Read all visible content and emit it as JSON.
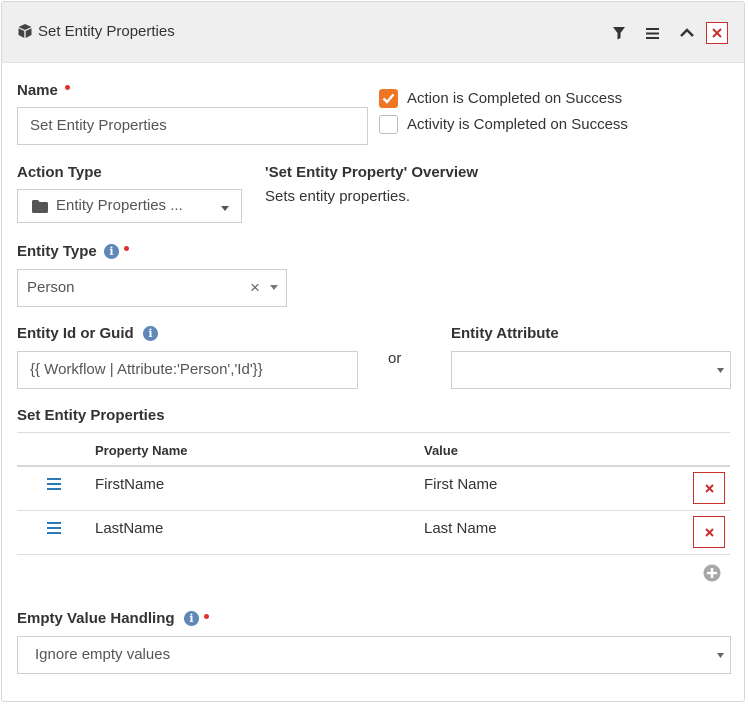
{
  "header": {
    "title": "Set Entity Properties",
    "icon": "cube-icon",
    "buttons": [
      "filter-icon",
      "menu-icon",
      "chevron-up-icon",
      "close-icon"
    ]
  },
  "form": {
    "name": {
      "label": "Name",
      "value": "Set Entity Properties"
    },
    "checkboxes": [
      {
        "label": "Action is Completed on Success",
        "checked": true
      },
      {
        "label": "Activity is Completed on Success",
        "checked": false
      }
    ],
    "action_type": {
      "label": "Action Type",
      "value": "Entity Properties ..."
    },
    "overview": {
      "title": "'Set Entity Property' Overview",
      "description": "Sets entity properties."
    },
    "entity_type": {
      "label": "Entity Type",
      "value": "Person",
      "clear": "×"
    },
    "entity_id": {
      "label": "Entity Id or Guid",
      "value": "{{ Workflow | Attribute:'Person','Id'}}"
    },
    "or_text": "or",
    "entity_attribute": {
      "label": "Entity Attribute",
      "value": ""
    },
    "set_props": {
      "label": "Set Entity Properties",
      "columns": [
        "Property Name",
        "Value"
      ],
      "rows": [
        {
          "name": "FirstName",
          "value": "First Name"
        },
        {
          "name": "LastName",
          "value": "Last Name"
        }
      ]
    },
    "empty_handling": {
      "label": "Empty Value Handling",
      "value": "Ignore empty values"
    }
  },
  "colors": {
    "accent": "#ee7624",
    "danger": "#c9302c",
    "info": "#5f87b8",
    "drag": "#2a7ab8"
  }
}
